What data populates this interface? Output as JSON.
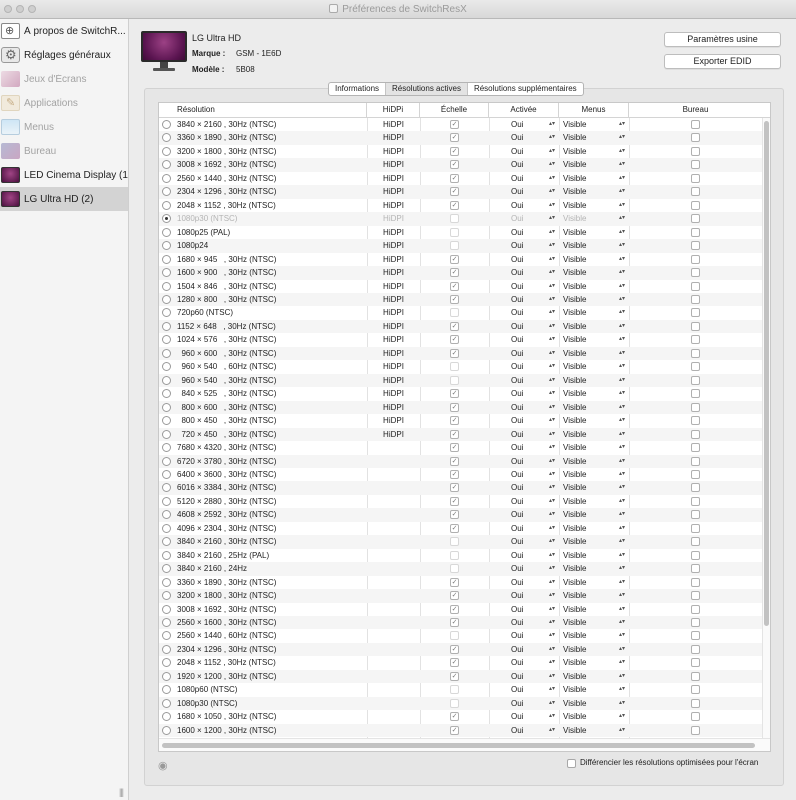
{
  "window": {
    "title": "Préférences de SwitchResX"
  },
  "sidebar": {
    "items": [
      {
        "label": "À propos de SwitchR...",
        "icon": "about-icon",
        "dim": false,
        "active": false
      },
      {
        "label": "Réglages généraux",
        "icon": "gear-icon",
        "dim": false,
        "active": false
      },
      {
        "label": "Jeux d'Écrans",
        "icon": "screens-icon",
        "dim": true,
        "active": false
      },
      {
        "label": "Applications",
        "icon": "applications-icon",
        "dim": true,
        "active": false
      },
      {
        "label": "Menus",
        "icon": "menus-icon",
        "dim": true,
        "active": false
      },
      {
        "label": "Bureau",
        "icon": "desktop-icon",
        "dim": true,
        "active": false
      },
      {
        "label": "LED Cinema Display (1)",
        "icon": "monitor-icon",
        "dim": false,
        "active": false
      },
      {
        "label": "LG Ultra HD (2)",
        "icon": "monitor-icon",
        "dim": false,
        "active": true
      }
    ]
  },
  "monitor": {
    "name": "LG Ultra HD",
    "brand_label": "Marque :",
    "brand_value": "GSM - 1E6D",
    "model_label": "Modèle :",
    "model_value": "5B08"
  },
  "buttons": {
    "factory": "Paramètres usine",
    "export": "Exporter EDID"
  },
  "tabs": [
    {
      "label": "Informations",
      "selected": false
    },
    {
      "label": "Résolutions actives",
      "selected": true
    },
    {
      "label": "Résolutions supplémentaires",
      "selected": false
    }
  ],
  "table": {
    "columns": {
      "resolution": "Résolution",
      "hidpi": "HiDPi",
      "scale": "Échelle",
      "active": "Activée",
      "menus": "Menus",
      "desktop": "Bureau"
    },
    "rows": [
      {
        "res": "3840 × 2160 , 30Hz (NTSC)",
        "hidpi": "HiDPI",
        "scale": true,
        "active": "Oui",
        "menu": "Visible",
        "selected": false,
        "disabled": false
      },
      {
        "res": "3360 × 1890 , 30Hz (NTSC)",
        "hidpi": "HiDPI",
        "scale": true,
        "active": "Oui",
        "menu": "Visible",
        "selected": false,
        "disabled": false
      },
      {
        "res": "3200 × 1800 , 30Hz (NTSC)",
        "hidpi": "HiDPI",
        "scale": true,
        "active": "Oui",
        "menu": "Visible",
        "selected": false,
        "disabled": false
      },
      {
        "res": "3008 × 1692 , 30Hz (NTSC)",
        "hidpi": "HiDPI",
        "scale": true,
        "active": "Oui",
        "menu": "Visible",
        "selected": false,
        "disabled": false
      },
      {
        "res": "2560 × 1440 , 30Hz (NTSC)",
        "hidpi": "HiDPI",
        "scale": true,
        "active": "Oui",
        "menu": "Visible",
        "selected": false,
        "disabled": false
      },
      {
        "res": "2304 × 1296 , 30Hz (NTSC)",
        "hidpi": "HiDPI",
        "scale": true,
        "active": "Oui",
        "menu": "Visible",
        "selected": false,
        "disabled": false
      },
      {
        "res": "2048 × 1152 , 30Hz (NTSC)",
        "hidpi": "HiDPI",
        "scale": true,
        "active": "Oui",
        "menu": "Visible",
        "selected": false,
        "disabled": false
      },
      {
        "res": "1080p30 (NTSC)",
        "hidpi": "HiDPI",
        "scale": false,
        "active": "Oui",
        "menu": "Visible",
        "selected": true,
        "disabled": true
      },
      {
        "res": "1080p25 (PAL)",
        "hidpi": "HiDPI",
        "scale": false,
        "active": "Oui",
        "menu": "Visible",
        "selected": false,
        "disabled": false
      },
      {
        "res": "1080p24",
        "hidpi": "HiDPI",
        "scale": false,
        "active": "Oui",
        "menu": "Visible",
        "selected": false,
        "disabled": false
      },
      {
        "res": "1680 × 945   , 30Hz (NTSC)",
        "hidpi": "HiDPI",
        "scale": true,
        "active": "Oui",
        "menu": "Visible",
        "selected": false,
        "disabled": false
      },
      {
        "res": "1600 × 900   , 30Hz (NTSC)",
        "hidpi": "HiDPI",
        "scale": true,
        "active": "Oui",
        "menu": "Visible",
        "selected": false,
        "disabled": false
      },
      {
        "res": "1504 × 846   , 30Hz (NTSC)",
        "hidpi": "HiDPI",
        "scale": true,
        "active": "Oui",
        "menu": "Visible",
        "selected": false,
        "disabled": false
      },
      {
        "res": "1280 × 800   , 30Hz (NTSC)",
        "hidpi": "HiDPI",
        "scale": true,
        "active": "Oui",
        "menu": "Visible",
        "selected": false,
        "disabled": false
      },
      {
        "res": "720p60 (NTSC)",
        "hidpi": "HiDPI",
        "scale": false,
        "active": "Oui",
        "menu": "Visible",
        "selected": false,
        "disabled": false
      },
      {
        "res": "1152 × 648   , 30Hz (NTSC)",
        "hidpi": "HiDPI",
        "scale": true,
        "active": "Oui",
        "menu": "Visible",
        "selected": false,
        "disabled": false
      },
      {
        "res": "1024 × 576   , 30Hz (NTSC)",
        "hidpi": "HiDPI",
        "scale": true,
        "active": "Oui",
        "menu": "Visible",
        "selected": false,
        "disabled": false
      },
      {
        "res": "  960 × 600   , 30Hz (NTSC)",
        "hidpi": "HiDPI",
        "scale": true,
        "active": "Oui",
        "menu": "Visible",
        "selected": false,
        "disabled": false
      },
      {
        "res": "  960 × 540   , 60Hz (NTSC)",
        "hidpi": "HiDPI",
        "scale": false,
        "active": "Oui",
        "menu": "Visible",
        "selected": false,
        "disabled": false
      },
      {
        "res": "  960 × 540   , 30Hz (NTSC)",
        "hidpi": "HiDPI",
        "scale": false,
        "active": "Oui",
        "menu": "Visible",
        "selected": false,
        "disabled": false
      },
      {
        "res": "  840 × 525   , 30Hz (NTSC)",
        "hidpi": "HiDPI",
        "scale": true,
        "active": "Oui",
        "menu": "Visible",
        "selected": false,
        "disabled": false
      },
      {
        "res": "  800 × 600   , 30Hz (NTSC)",
        "hidpi": "HiDPI",
        "scale": true,
        "active": "Oui",
        "menu": "Visible",
        "selected": false,
        "disabled": false
      },
      {
        "res": "  800 × 450   , 30Hz (NTSC)",
        "hidpi": "HiDPI",
        "scale": true,
        "active": "Oui",
        "menu": "Visible",
        "selected": false,
        "disabled": false
      },
      {
        "res": "  720 × 450   , 30Hz (NTSC)",
        "hidpi": "HiDPI",
        "scale": true,
        "active": "Oui",
        "menu": "Visible",
        "selected": false,
        "disabled": false
      },
      {
        "res": "7680 × 4320 , 30Hz (NTSC)",
        "hidpi": "",
        "scale": true,
        "active": "Oui",
        "menu": "Visible",
        "selected": false,
        "disabled": false
      },
      {
        "res": "6720 × 3780 , 30Hz (NTSC)",
        "hidpi": "",
        "scale": true,
        "active": "Oui",
        "menu": "Visible",
        "selected": false,
        "disabled": false
      },
      {
        "res": "6400 × 3600 , 30Hz (NTSC)",
        "hidpi": "",
        "scale": true,
        "active": "Oui",
        "menu": "Visible",
        "selected": false,
        "disabled": false
      },
      {
        "res": "6016 × 3384 , 30Hz (NTSC)",
        "hidpi": "",
        "scale": true,
        "active": "Oui",
        "menu": "Visible",
        "selected": false,
        "disabled": false
      },
      {
        "res": "5120 × 2880 , 30Hz (NTSC)",
        "hidpi": "",
        "scale": true,
        "active": "Oui",
        "menu": "Visible",
        "selected": false,
        "disabled": false
      },
      {
        "res": "4608 × 2592 , 30Hz (NTSC)",
        "hidpi": "",
        "scale": true,
        "active": "Oui",
        "menu": "Visible",
        "selected": false,
        "disabled": false
      },
      {
        "res": "4096 × 2304 , 30Hz (NTSC)",
        "hidpi": "",
        "scale": true,
        "active": "Oui",
        "menu": "Visible",
        "selected": false,
        "disabled": false
      },
      {
        "res": "3840 × 2160 , 30Hz (NTSC)",
        "hidpi": "",
        "scale": false,
        "active": "Oui",
        "menu": "Visible",
        "selected": false,
        "disabled": false
      },
      {
        "res": "3840 × 2160 , 25Hz (PAL)",
        "hidpi": "",
        "scale": false,
        "active": "Oui",
        "menu": "Visible",
        "selected": false,
        "disabled": false
      },
      {
        "res": "3840 × 2160 , 24Hz",
        "hidpi": "",
        "scale": false,
        "active": "Oui",
        "menu": "Visible",
        "selected": false,
        "disabled": false
      },
      {
        "res": "3360 × 1890 , 30Hz (NTSC)",
        "hidpi": "",
        "scale": true,
        "active": "Oui",
        "menu": "Visible",
        "selected": false,
        "disabled": false
      },
      {
        "res": "3200 × 1800 , 30Hz (NTSC)",
        "hidpi": "",
        "scale": true,
        "active": "Oui",
        "menu": "Visible",
        "selected": false,
        "disabled": false
      },
      {
        "res": "3008 × 1692 , 30Hz (NTSC)",
        "hidpi": "",
        "scale": true,
        "active": "Oui",
        "menu": "Visible",
        "selected": false,
        "disabled": false
      },
      {
        "res": "2560 × 1600 , 30Hz (NTSC)",
        "hidpi": "",
        "scale": true,
        "active": "Oui",
        "menu": "Visible",
        "selected": false,
        "disabled": false
      },
      {
        "res": "2560 × 1440 , 60Hz (NTSC)",
        "hidpi": "",
        "scale": false,
        "active": "Oui",
        "menu": "Visible",
        "selected": false,
        "disabled": false
      },
      {
        "res": "2304 × 1296 , 30Hz (NTSC)",
        "hidpi": "",
        "scale": true,
        "active": "Oui",
        "menu": "Visible",
        "selected": false,
        "disabled": false
      },
      {
        "res": "2048 × 1152 , 30Hz (NTSC)",
        "hidpi": "",
        "scale": true,
        "active": "Oui",
        "menu": "Visible",
        "selected": false,
        "disabled": false
      },
      {
        "res": "1920 × 1200 , 30Hz (NTSC)",
        "hidpi": "",
        "scale": true,
        "active": "Oui",
        "menu": "Visible",
        "selected": false,
        "disabled": false
      },
      {
        "res": "1080p60 (NTSC)",
        "hidpi": "",
        "scale": false,
        "active": "Oui",
        "menu": "Visible",
        "selected": false,
        "disabled": false
      },
      {
        "res": "1080p30 (NTSC)",
        "hidpi": "",
        "scale": false,
        "active": "Oui",
        "menu": "Visible",
        "selected": false,
        "disabled": false
      },
      {
        "res": "1680 × 1050 , 30Hz (NTSC)",
        "hidpi": "",
        "scale": true,
        "active": "Oui",
        "menu": "Visible",
        "selected": false,
        "disabled": false
      },
      {
        "res": "1600 × 1200 , 30Hz (NTSC)",
        "hidpi": "",
        "scale": true,
        "active": "Oui",
        "menu": "Visible",
        "selected": false,
        "disabled": false
      }
    ]
  },
  "footer": {
    "checkbox_label": "Différencier les résolutions optimisées pour l'écran",
    "eye_icon": "eye-icon"
  },
  "colors": {
    "selected_sidebar": "#d3d3d3",
    "monitor_purple": "#7a2a6c"
  }
}
